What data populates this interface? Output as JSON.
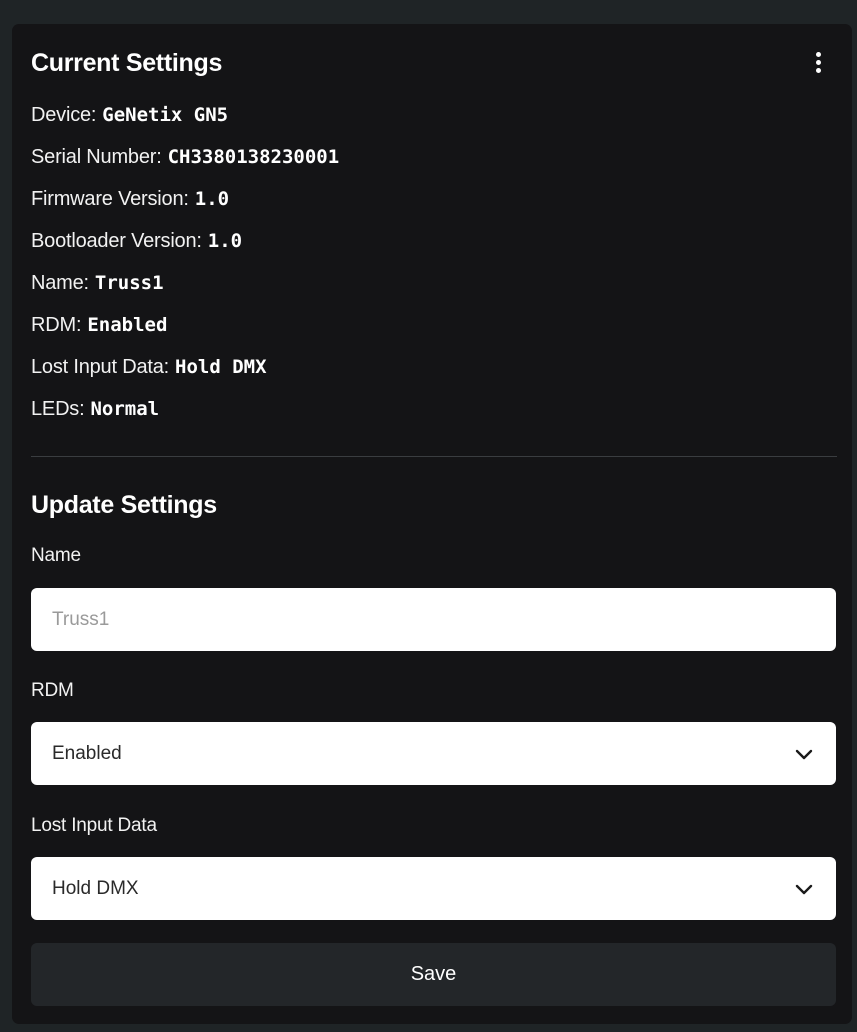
{
  "current_settings": {
    "title": "Current Settings",
    "menu_icon": "kebab-menu-icon",
    "rows": [
      {
        "label": "Device:",
        "value": "GeNetix GN5"
      },
      {
        "label": "Serial Number:",
        "value": "CH3380138230001"
      },
      {
        "label": "Firmware Version:",
        "value": "1.0"
      },
      {
        "label": "Bootloader Version:",
        "value": "1.0"
      },
      {
        "label": "Name:",
        "value": "Truss1"
      },
      {
        "label": "RDM:",
        "value": "Enabled"
      },
      {
        "label": "Lost Input Data:",
        "value": "Hold DMX"
      },
      {
        "label": "LEDs:",
        "value": "Normal"
      }
    ]
  },
  "update_settings": {
    "title": "Update Settings",
    "name_field": {
      "label": "Name",
      "value": "",
      "placeholder": "Truss1"
    },
    "rdm_field": {
      "label": "RDM",
      "selected": "Enabled",
      "icon": "chevron-down-icon"
    },
    "lost_input_field": {
      "label": "Lost Input Data",
      "selected": "Hold DMX",
      "icon": "chevron-down-icon"
    },
    "save_label": "Save"
  },
  "colors": {
    "page_background": "#1f2426",
    "panel_background": "#141416",
    "button_background": "#232629",
    "divider": "#3a3d40",
    "text": "#ffffff"
  }
}
